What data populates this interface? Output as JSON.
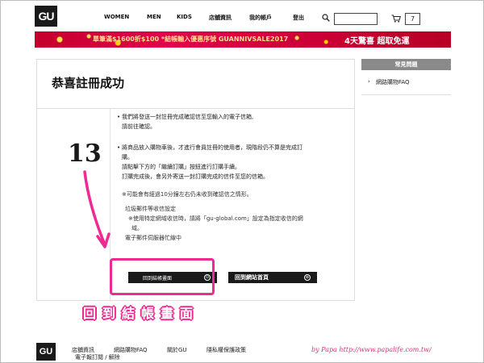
{
  "header": {
    "logo": "GU",
    "nav": [
      {
        "label": "WOMEN",
        "name": "nav-women"
      },
      {
        "label": "MEN",
        "name": "nav-men"
      },
      {
        "label": "KIDS",
        "name": "nav-kids"
      },
      {
        "label": "店舖資訊",
        "name": "nav-store-info"
      },
      {
        "label": "我的帳戶",
        "name": "nav-my-account"
      },
      {
        "label": "登出",
        "name": "nav-logout"
      }
    ],
    "search_placeholder": "",
    "cart_count": "7"
  },
  "banner": {
    "text": "單筆滿$1600折$100 *結帳輸入優惠序號 GUANNIVSALE2017",
    "right_text": "4天驚喜  超取免運"
  },
  "main": {
    "title": "恭喜註冊成功",
    "paragraphs": [
      {
        "lines": [
          "我們將發送一封註冊完成確認信至您輸入的電子信箱,",
          "請前往確認。"
        ]
      },
      {
        "lines": [
          "將商品放入購物車後，才進行會員註冊的使用者，現階段仍不算是完成訂",
          "購。",
          "請點擊下方的「繼續訂購」按鈕進行訂購手續。",
          "訂購完成後，會另外寄送一封訂購完成的信件至您的信箱。"
        ]
      }
    ],
    "note_lines": [
      "※可能會有經過10分鐘左右仍未收到確認信之情形。",
      "垃圾郵件等收信設定",
      "※使用特定網域收信時，請將「gu-global.com」設定為指定收信的網",
      "域。",
      "電子郵件伺服器忙線中"
    ],
    "btn_back": "回到結帳畫面",
    "btn_home": "回到網站首頁",
    "btn_icon": "⊙"
  },
  "sidebar": {
    "heading": "常見問題",
    "items": [
      "網路購物FAQ"
    ]
  },
  "footer": {
    "logo": "GU",
    "links": [
      "店舖資訊",
      "網路購物FAQ",
      "關於GU",
      "隱私權保護政策"
    ],
    "link2": "電子報訂閱 / 解除"
  },
  "annotations": {
    "step_number": "13",
    "caption": "回到結帳畫面",
    "credit": "by Papa  http://www.papalife.com.tw/"
  },
  "colors": {
    "annotation": "#ee2a93",
    "banner": "#d1003a",
    "button": "#1a1a1a"
  }
}
